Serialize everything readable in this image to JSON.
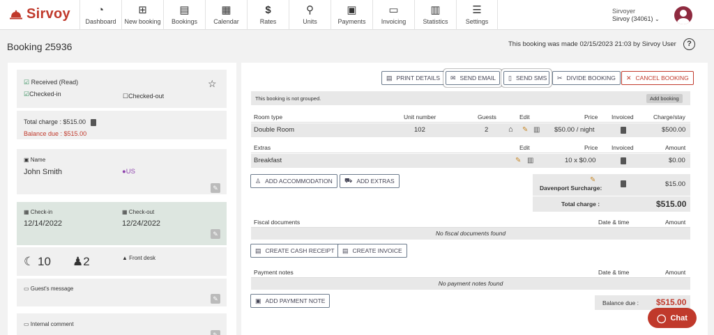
{
  "app": {
    "name": "Sirvoy"
  },
  "nav": [
    {
      "label": "Dashboard",
      "icon": "dashboard-icon"
    },
    {
      "label": "New booking",
      "icon": "new-booking-icon"
    },
    {
      "label": "Bookings",
      "icon": "bookings-icon"
    },
    {
      "label": "Calendar",
      "icon": "calendar-icon"
    },
    {
      "label": "Rates",
      "icon": "dollar-icon"
    },
    {
      "label": "Units",
      "icon": "units-icon"
    },
    {
      "label": "Payments",
      "icon": "payments-icon"
    },
    {
      "label": "Invoicing",
      "icon": "invoicing-icon"
    },
    {
      "label": "Statistics",
      "icon": "statistics-icon"
    },
    {
      "label": "Settings",
      "icon": "settings-icon"
    }
  ],
  "user": {
    "line1": "Sirvoyer",
    "line2": "Sirvoy (34061)"
  },
  "page": {
    "title": "Booking 25936",
    "made": "This booking was made 02/15/2023 21:03 by Sirvoy User",
    "help": "?"
  },
  "left": {
    "received": "Received (Read)",
    "checkedin": "Checked-in",
    "checkedout": "Checked-out",
    "total_charge": "Total charge : $515.00",
    "balance_due": "Balance due : $515.00",
    "name_label": "Name",
    "name": "John Smith",
    "country": "US",
    "checkin_label": "Check-in",
    "checkin": "12/14/2022",
    "checkout_label": "Check-out",
    "checkout": "12/24/2022",
    "nights": "10",
    "guests": "2",
    "front_desk": "Front desk",
    "guest_message": "Guest's message",
    "internal_comment": "Internal comment"
  },
  "actions": {
    "print": "PRINT DETAILS",
    "email": "SEND EMAIL",
    "sms": "SEND SMS",
    "divide": "DIVIDE BOOKING",
    "cancel": "CANCEL BOOKING"
  },
  "group": {
    "text": "This booking is not grouped.",
    "add": "Add booking"
  },
  "rooms": {
    "headers": [
      "Room type",
      "Unit number",
      "Guests",
      "Edit",
      "Price",
      "Invoiced",
      "Charge/stay"
    ],
    "rows": [
      {
        "type": "Double Room",
        "unit": "102",
        "guests": "2",
        "price": "$50.00 / night",
        "charge": "$500.00"
      }
    ]
  },
  "extras": {
    "headers": [
      "Extras",
      "Edit",
      "Price",
      "Invoiced",
      "Amount"
    ],
    "rows": [
      {
        "name": "Breakfast",
        "price": "10 x $0.00",
        "amount": "$0.00"
      }
    ]
  },
  "add": {
    "accommodation": "ADD ACCOMMODATION",
    "extras": "ADD EXTRAS"
  },
  "surcharge": {
    "label": "Davenport Surcharge:",
    "amount": "$15.00",
    "total_label": "Total charge :",
    "total": "$515.00"
  },
  "fiscal": {
    "title": "Fiscal documents",
    "date": "Date & time",
    "amount": "Amount",
    "empty": "No fiscal documents found",
    "receipt": "CREATE CASH RECEIPT",
    "invoice": "CREATE INVOICE"
  },
  "payments": {
    "title": "Payment notes",
    "date": "Date & time",
    "amount": "Amount",
    "empty": "No payment notes found",
    "add": "ADD PAYMENT NOTE",
    "balance_label": "Balance due :",
    "balance": "$515.00"
  },
  "chat": "Chat"
}
